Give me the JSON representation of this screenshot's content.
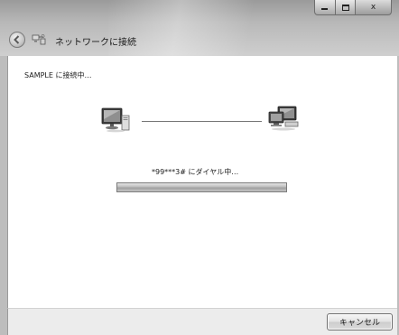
{
  "window": {
    "title": "ネットワークに接続",
    "caption_buttons": {
      "minimize_icon": "minimize-icon",
      "maximize_icon": "maximize-icon",
      "close_label": "x"
    },
    "back_icon": "back-arrow-icon",
    "title_icon": "network-connection-icon"
  },
  "main": {
    "status": "SAMPLE に接続中…",
    "local_icon": "local-computer-icon",
    "remote_icon": "remote-network-icon",
    "dial_status": "*99***3# にダイヤル中…",
    "progress": 1.0
  },
  "footer": {
    "cancel_label": "キャンセル"
  },
  "colors": {
    "titlebar": "#b8b8b8",
    "content_bg": "#ffffff",
    "footer_bg": "#ececec"
  }
}
